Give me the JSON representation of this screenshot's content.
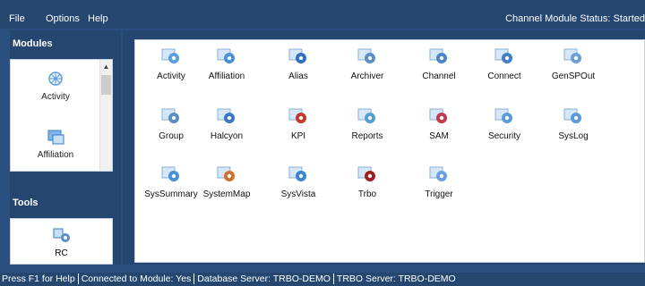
{
  "menu": {
    "file": "File",
    "options": "Options",
    "help": "Help",
    "status": "Channel Module Status: Started"
  },
  "sidebar": {
    "modules_title": "Modules",
    "tools_title": "Tools",
    "modules": [
      {
        "label": "Activity",
        "icon": "activity-icon"
      },
      {
        "label": "Affiliation",
        "icon": "affiliation-icon"
      }
    ],
    "tools": [
      {
        "label": "RC",
        "icon": "rc-icon"
      }
    ]
  },
  "main": {
    "modules": [
      {
        "label": "Activity",
        "icon": "activity-icon",
        "color": "#5aa0e0"
      },
      {
        "label": "Affiliation",
        "icon": "affiliation-icon",
        "color": "#4a90d9"
      },
      {
        "label": "Alias",
        "icon": "alias-icon",
        "color": "#2f6fc4"
      },
      {
        "label": "Archiver",
        "icon": "archiver-icon",
        "color": "#5b8fc8"
      },
      {
        "label": "Channel",
        "icon": "channel-icon",
        "color": "#4a86c8"
      },
      {
        "label": "Connect",
        "icon": "connect-icon",
        "color": "#3f7fc2"
      },
      {
        "label": "GenSPOut",
        "icon": "genspout-icon",
        "color": "#6a9fd8"
      },
      {
        "label": "Group",
        "icon": "group-icon",
        "color": "#5a8ec4"
      },
      {
        "label": "Halcyon",
        "icon": "halcyon-icon",
        "color": "#3a78c6"
      },
      {
        "label": "KPI",
        "icon": "kpi-icon",
        "color": "#c0392b"
      },
      {
        "label": "Reports",
        "icon": "reports-icon",
        "color": "#4fa0d0"
      },
      {
        "label": "SAM",
        "icon": "sam-icon",
        "color": "#c0394f"
      },
      {
        "label": "Security",
        "icon": "security-icon",
        "color": "#5a9ad8"
      },
      {
        "label": "SysLog",
        "icon": "syslog-icon",
        "color": "#5a9ad8"
      },
      {
        "label": "SysSummary",
        "icon": "syssummary-icon",
        "color": "#4a90d9"
      },
      {
        "label": "SystemMap",
        "icon": "systemmap-icon",
        "color": "#d07030"
      },
      {
        "label": "SysVista",
        "icon": "sysvista-icon",
        "color": "#3a84d0"
      },
      {
        "label": "Trbo",
        "icon": "trbo-icon",
        "color": "#a02020"
      },
      {
        "label": "Trigger",
        "icon": "trigger-icon",
        "color": "#6aa0e0"
      }
    ]
  },
  "statusbar": {
    "help": "Press F1 for Help",
    "connected": "Connected to Module: Yes",
    "db_server": "Database Server:  TRBO-DEMO",
    "trbo_server": "TRBO Server:  TRBO-DEMO"
  }
}
